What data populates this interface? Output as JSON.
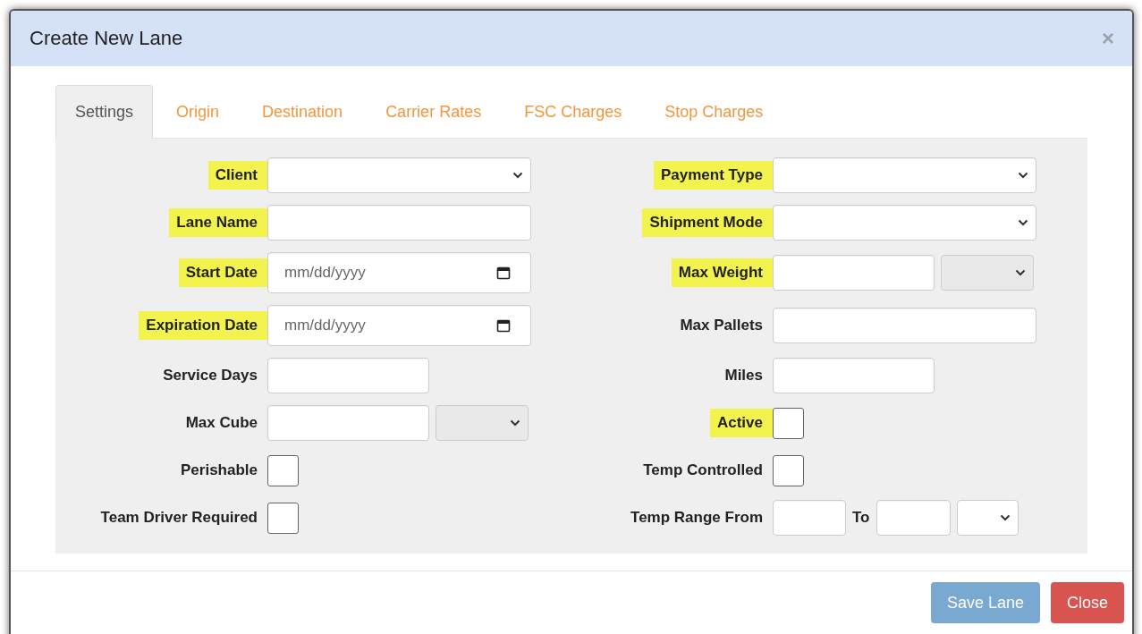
{
  "modal": {
    "title": "Create New Lane",
    "close": "×"
  },
  "tabs": [
    {
      "label": "Settings",
      "selected": true
    },
    {
      "label": "Origin",
      "selected": false
    },
    {
      "label": "Destination",
      "selected": false
    },
    {
      "label": "Carrier Rates",
      "selected": false
    },
    {
      "label": "FSC Charges",
      "selected": false
    },
    {
      "label": "Stop Charges",
      "selected": false
    }
  ],
  "left_fields": [
    {
      "label": "Client",
      "highlighted": true,
      "kind": "select"
    },
    {
      "label": "Lane Name",
      "highlighted": true,
      "kind": "text"
    },
    {
      "label": "Start Date",
      "highlighted": true,
      "kind": "date",
      "placeholder": "mm/dd/yyyy"
    },
    {
      "label": "Expiration Date",
      "highlighted": true,
      "kind": "date",
      "placeholder": "mm/dd/yyyy"
    },
    {
      "label": "Service Days",
      "highlighted": false,
      "kind": "number"
    },
    {
      "label": "Max Cube",
      "highlighted": false,
      "kind": "number_unit",
      "unit": {
        "disabled": true
      }
    },
    {
      "label": "Perishable",
      "highlighted": false,
      "kind": "checkbox",
      "checked": false
    },
    {
      "label": "Team Driver Required",
      "highlighted": false,
      "kind": "checkbox",
      "checked": false
    }
  ],
  "right_fields": [
    {
      "label": "Payment Type",
      "highlighted": true,
      "kind": "select"
    },
    {
      "label": "Shipment Mode",
      "highlighted": true,
      "kind": "select"
    },
    {
      "label": "Max Weight",
      "highlighted": true,
      "kind": "number_unit",
      "unit": {
        "disabled": true
      }
    },
    {
      "label": "Max Pallets",
      "highlighted": false,
      "kind": "text"
    },
    {
      "label": "Miles",
      "highlighted": false,
      "kind": "number"
    },
    {
      "label": "Active",
      "highlighted": true,
      "kind": "checkbox",
      "checked": false
    },
    {
      "label": "Temp Controlled",
      "highlighted": false,
      "kind": "checkbox",
      "checked": false
    },
    {
      "label": "Temp Range From",
      "highlighted": false,
      "kind": "range",
      "to_label": "To",
      "unit": {
        "disabled": false
      }
    }
  ],
  "buttons": [
    {
      "label": "Save Lane",
      "kind": "primary",
      "disabled": true
    },
    {
      "label": "Close",
      "kind": "danger",
      "disabled": false
    }
  ]
}
